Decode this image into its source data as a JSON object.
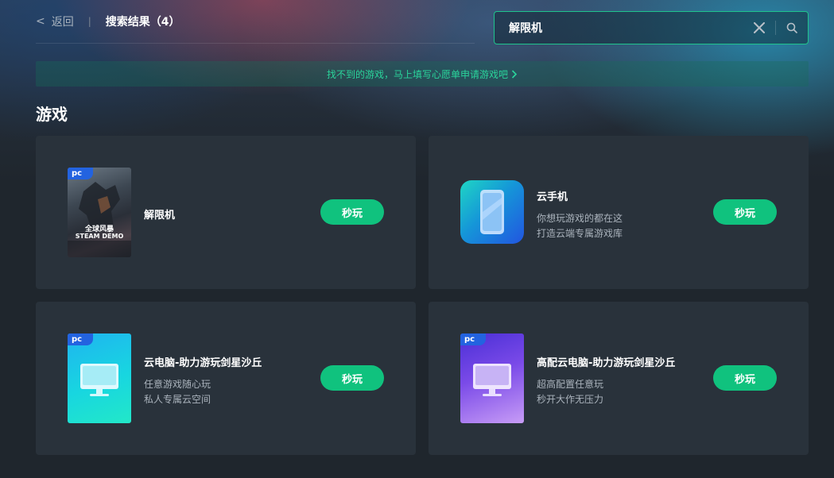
{
  "header": {
    "back_chevron": "<",
    "back_label": "返回",
    "divider": "|",
    "result_title": "搜索结果（4）"
  },
  "search": {
    "value": "解限机",
    "clear_icon": "close-icon",
    "search_icon": "search-icon"
  },
  "banner": {
    "text": "找不到的游戏，马上填写心愿单申请游戏吧",
    "arrow_icon": "chevron-right-icon"
  },
  "section": {
    "title": "游戏"
  },
  "colors": {
    "accent": "#10c27e",
    "border_accent": "#1fc48d",
    "tag_blue": "#2363e0",
    "card_bg": "#29323b"
  },
  "cards": [
    {
      "name": "解限机",
      "tag": "pc",
      "desc1": "",
      "desc2": "",
      "button": "秒玩",
      "cover_lines": [
        "全球风暴",
        "STEAM DEMO"
      ]
    },
    {
      "name": "云手机",
      "tag": "",
      "desc1": "你想玩游戏的都在这",
      "desc2": "打造云端专属游戏库",
      "button": "秒玩"
    },
    {
      "name": "云电脑-助力游玩剑星沙丘",
      "tag": "pc",
      "desc1": "任意游戏随心玩",
      "desc2": "私人专属云空间",
      "button": "秒玩"
    },
    {
      "name": "高配云电脑-助力游玩剑星沙丘",
      "tag": "pc",
      "desc1": "超高配置任意玩",
      "desc2": "秒开大作无压力",
      "button": "秒玩"
    }
  ]
}
